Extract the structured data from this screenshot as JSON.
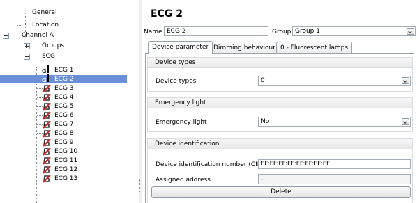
{
  "tree": {
    "items": [
      {
        "label": "General"
      },
      {
        "label": "Location"
      },
      {
        "label": "Channel A"
      },
      {
        "label": "Groups"
      },
      {
        "label": "ECG"
      },
      {
        "label": "ECG 1",
        "icon_text": "G"
      },
      {
        "label": "ECG 2",
        "icon_text": "G"
      },
      {
        "label": "ECG 3"
      },
      {
        "label": "ECG 4"
      },
      {
        "label": "ECG 5"
      },
      {
        "label": "ECG 6"
      },
      {
        "label": "ECG 7"
      },
      {
        "label": "ECG 8"
      },
      {
        "label": "ECG 9"
      },
      {
        "label": "ECG 10"
      },
      {
        "label": "ECG 11"
      },
      {
        "label": "ECG 12"
      },
      {
        "label": "ECG 13"
      }
    ],
    "selected": "ECG 2"
  },
  "panel": {
    "title": "ECG 2",
    "name_label": "Name",
    "name_value": "ECG 2",
    "group_label": "Group",
    "group_value": "Group 1",
    "tabs": [
      {
        "label": "Device parameter"
      },
      {
        "label": "Dimming behaviour"
      },
      {
        "label": "0 - Fluorescent lamps"
      }
    ],
    "sections": {
      "device_types": {
        "header": "Device types",
        "label": "Device types",
        "value": "0"
      },
      "emergency": {
        "header": "Emergency light",
        "label": "Emergency light",
        "value": "No"
      },
      "identification": {
        "header": "Device identification",
        "cin_label": "Device identification number (CIN)",
        "cin_value": "FF:FF:FF:FF:FF:FF:FF:FF",
        "address_label": "Assigned address",
        "address_value": "-",
        "delete_label": "Delete"
      }
    }
  },
  "colors": {
    "selection": "#6a8fd8",
    "ecg_icon_red": "#d9261c"
  },
  "icons": {
    "expander": "tree-expander-icon",
    "ecg": "ecg-device-icon",
    "group": "group-marker-icon"
  }
}
